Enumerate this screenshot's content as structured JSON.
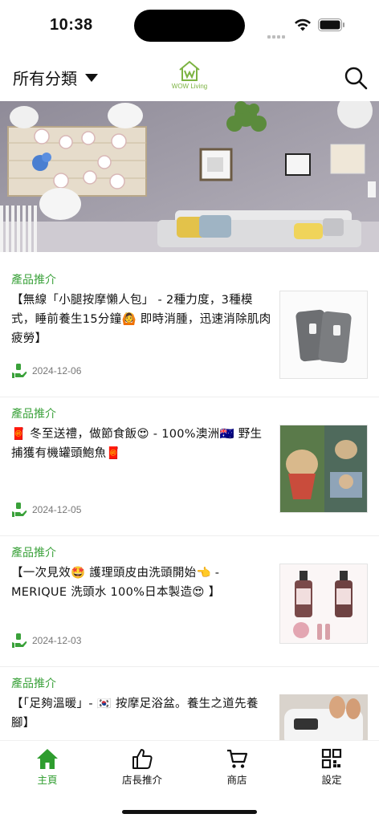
{
  "status_bar": {
    "time": "10:38"
  },
  "header": {
    "category_label": "所有分類",
    "logo_text": "WOW Living",
    "search_icon": "search-icon",
    "caret_icon": "caret-down-icon"
  },
  "hero": {
    "description_icon": "hero-banner-image"
  },
  "feed": {
    "items": [
      {
        "tag": "產品推介",
        "title": "【無線「小腿按摩懶人包」 - 2種力度，3種模式，睡前養生15分鐘🙆 即時消腫，迅速消除肌肉疲勞】",
        "date": "2024-12-06"
      },
      {
        "tag": "產品推介",
        "title": "🧧 冬至送禮，做節食飯😍 - 100%澳洲🇦🇺 野生捕獲有機罐頭鮑魚🧧",
        "date": "2024-12-05"
      },
      {
        "tag": "產品推介",
        "title": "【一次見效🤩 護理頭皮由洗頭開始👈 - MERIQUE 洗頭水 100%日本製造😍 】",
        "date": "2024-12-03"
      },
      {
        "tag": "產品推介",
        "title": "【「足夠溫暖」- 🇰🇷 按摩足浴盆。養生之道先養腳】",
        "date": ""
      }
    ]
  },
  "tabbar": {
    "tabs": [
      {
        "label": "主頁",
        "icon": "home-icon",
        "active": true
      },
      {
        "label": "店長推介",
        "icon": "thumbs-up-icon",
        "active": false
      },
      {
        "label": "商店",
        "icon": "cart-icon",
        "active": false
      },
      {
        "label": "設定",
        "icon": "grid-settings-icon",
        "active": false
      }
    ]
  },
  "colors": {
    "accent": "#3aa13a",
    "logo": "#7cb342",
    "text": "#111111",
    "muted": "#777777"
  }
}
